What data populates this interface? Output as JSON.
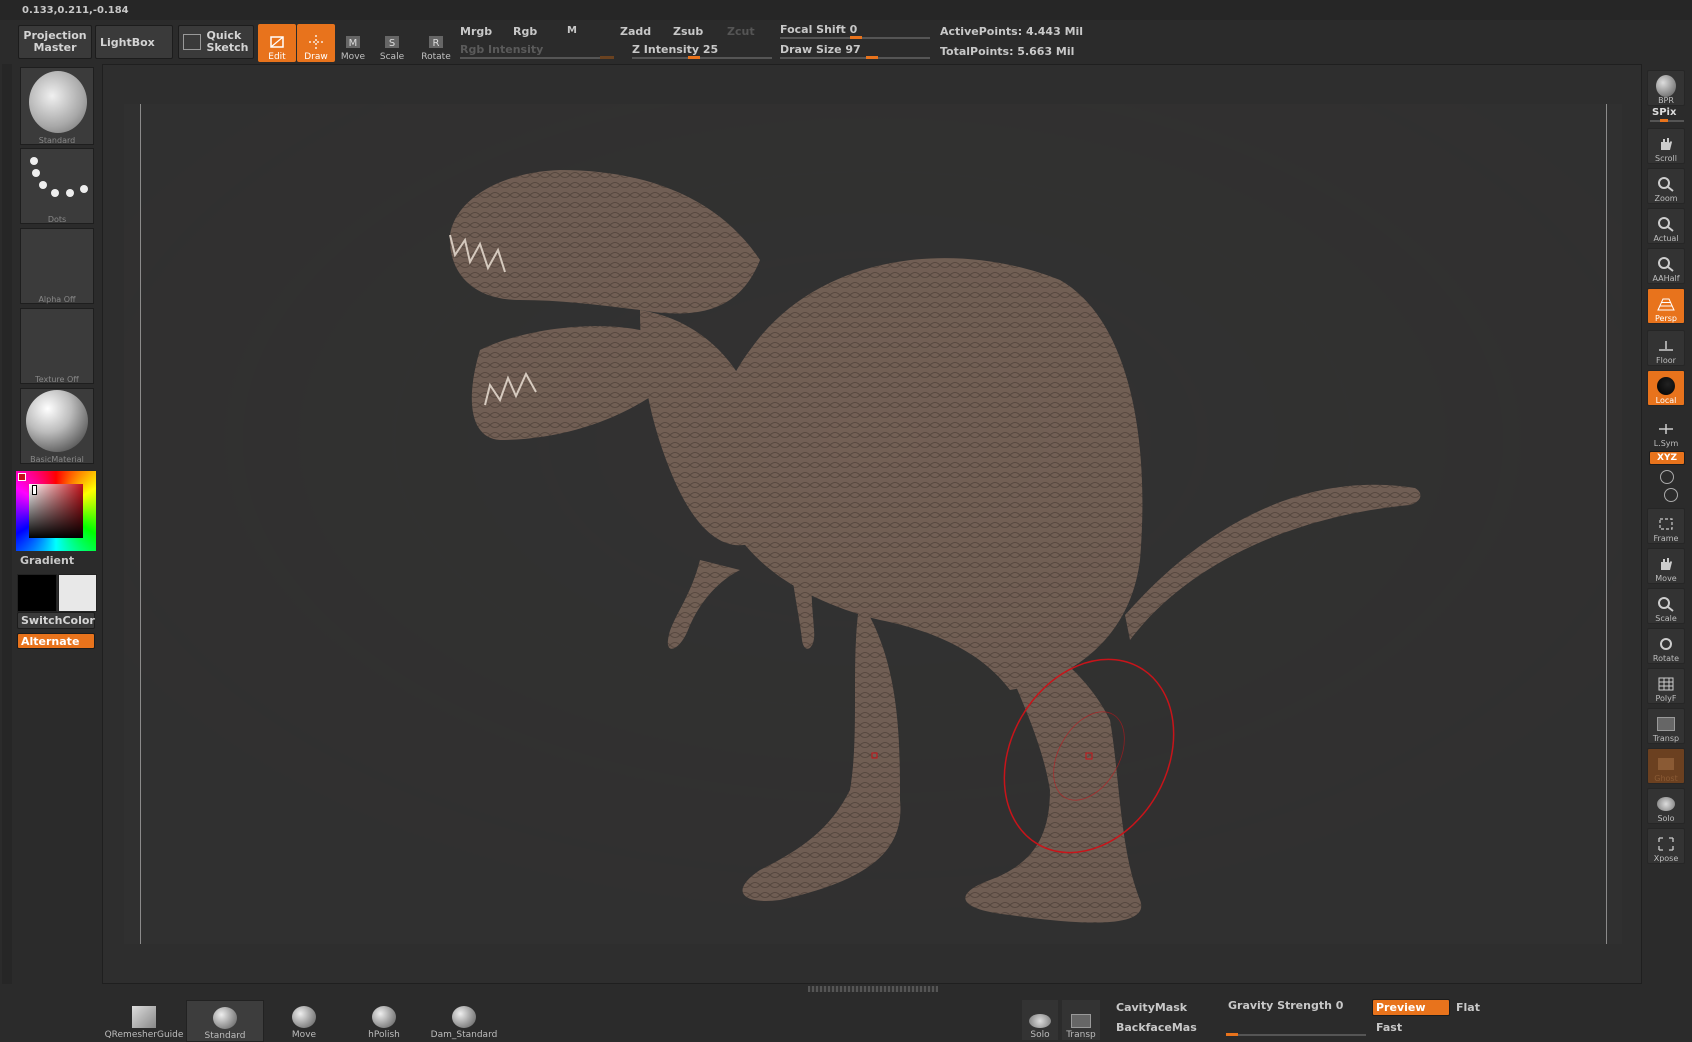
{
  "coords": "0.133,0.211,-0.184",
  "toolbar": {
    "projection_master_1": "Projection",
    "projection_master_2": "Master",
    "lightbox": "LightBox",
    "quick_sketch_1": "Quick",
    "quick_sketch_2": "Sketch",
    "edit": "Edit",
    "draw": "Draw",
    "move": "Move",
    "scale": "Scale",
    "rotate": "Rotate",
    "mrgb": "Mrgb",
    "rgb": "Rgb",
    "m": "M",
    "zadd": "Zadd",
    "zsub": "Zsub",
    "zcut": "Zcut",
    "rgb_intensity": "Rgb  Intensity",
    "z_intensity": "Z Intensity 25",
    "z_intensity_value": 25,
    "focal_shift": "Focal Shift 0",
    "focal_shift_value": 0,
    "draw_size": "Draw Size 97",
    "draw_size_value": 97,
    "active_points": "ActivePoints: 4.443  Mil",
    "total_points": "TotalPoints: 5.663  Mil"
  },
  "left": {
    "brush": "Standard",
    "stroke": "Dots",
    "alpha": "Alpha  Off",
    "texture": "Texture  Off",
    "material": "BasicMaterial",
    "gradient": "Gradient",
    "switch_color": "SwitchColor",
    "alternate": "Alternate"
  },
  "right": {
    "bpr": "BPR",
    "spix": "SPix",
    "scroll": "Scroll",
    "zoom": "Zoom",
    "actual": "Actual",
    "aahalf": "AAHalf",
    "persp": "Persp",
    "floor": "Floor",
    "local": "Local",
    "lsym": "L.Sym",
    "xyz": "XYZ",
    "frame": "Frame",
    "move": "Move",
    "scale": "Scale",
    "rotate": "Rotate",
    "polyf": "PolyF",
    "transp": "Transp",
    "ghost": "Ghost",
    "solo": "Solo",
    "xpose": "Xpose"
  },
  "bottom": {
    "qremesher": "QRemesherGuide",
    "standard": "Standard",
    "move": "Move",
    "hpolish": "hPolish",
    "dam_standard": "Dam_Standard",
    "solo": "Solo",
    "transp": "Transp",
    "cavity_mask": "CavityMask",
    "backface_mask": "BackfaceMas",
    "gravity_strength": "Gravity Strength 0",
    "gravity_strength_value": 0,
    "preview": "Preview",
    "flat": "Flat",
    "fast": "Fast"
  },
  "colors": {
    "accent": "#e8731c",
    "canvas": "#353535",
    "model": "#7d6a5f",
    "brush_ring": "#c8141a"
  }
}
